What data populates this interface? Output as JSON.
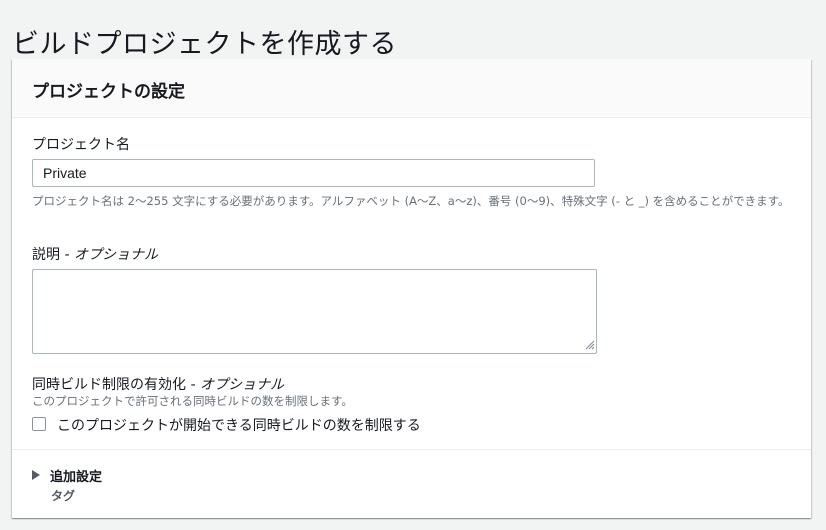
{
  "page": {
    "title": "ビルドプロジェクトを作成する"
  },
  "panel": {
    "title": "プロジェクトの設定",
    "project_name": {
      "label": "プロジェクト名",
      "value": "Private",
      "hint": "プロジェクト名は 2〜255 文字にする必要があります。アルファベット (A〜Z、a〜z)、番号 (0〜9)、特殊文字 (- と _) を含めることができます。"
    },
    "description": {
      "label": "説明",
      "optional_suffix": " - オプショナル",
      "value": ""
    },
    "concurrent_limit": {
      "label": "同時ビルド制限の有効化",
      "optional_suffix": " - オプショナル",
      "hint": "このプロジェクトで許可される同時ビルドの数を制限します。",
      "checkbox_label": "このプロジェクトが開始できる同時ビルドの数を制限する",
      "checked": false
    },
    "additional": {
      "label": "追加設定",
      "sub_label": "タグ"
    }
  },
  "colors": {
    "background": "#f2f3f3",
    "panel_header": "#fafafa",
    "hint_text": "#687078",
    "input_border": "#aab7b8"
  }
}
